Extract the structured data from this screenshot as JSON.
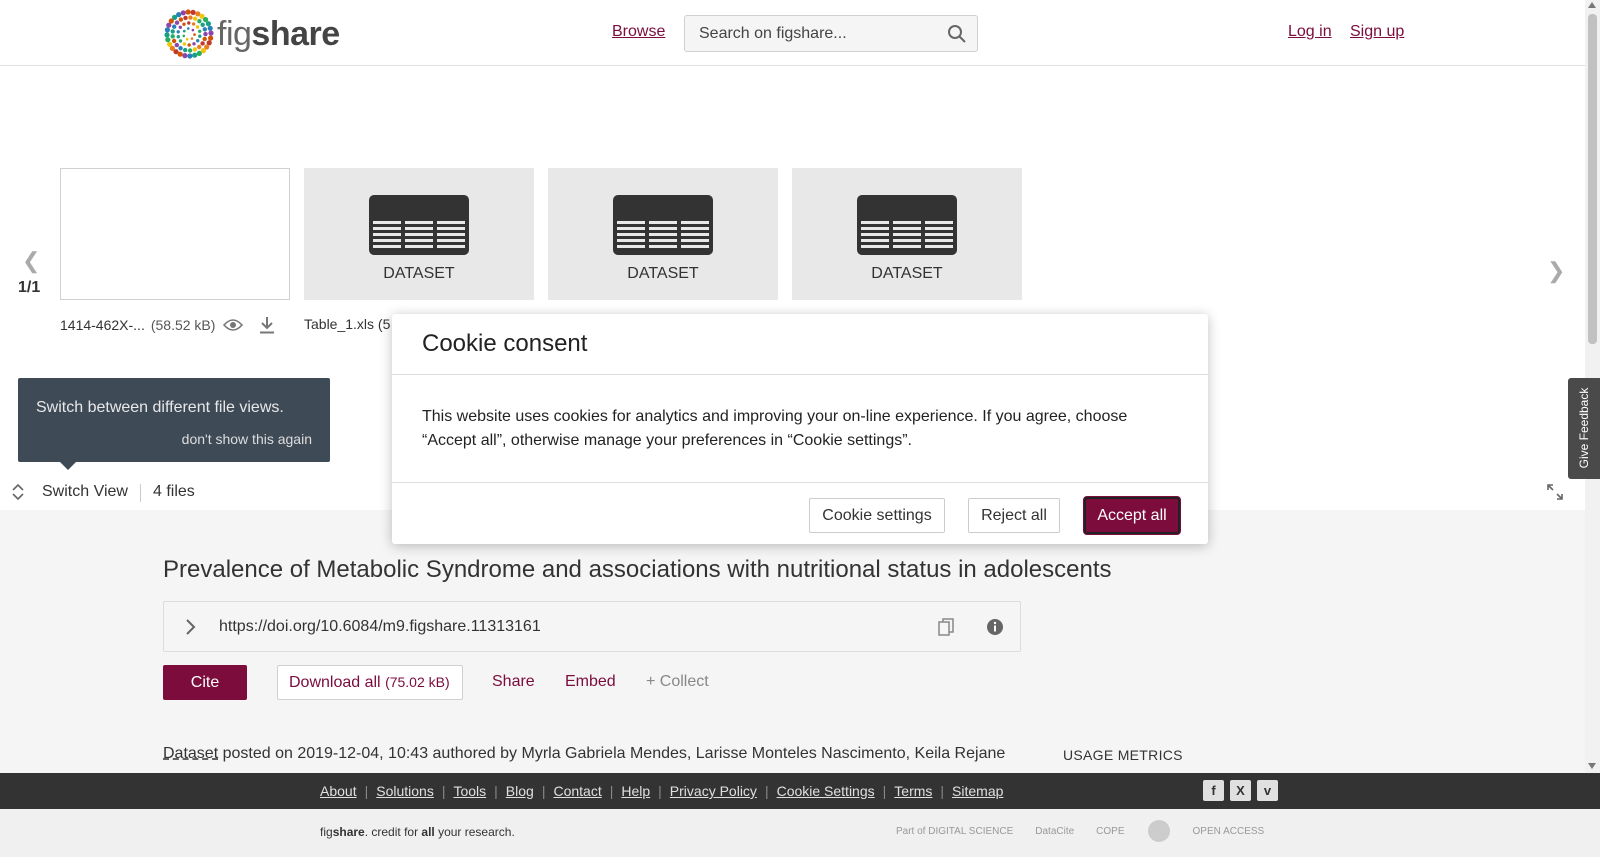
{
  "header": {
    "logo_text_light": "fig",
    "logo_text_bold": "share",
    "browse_label": "Browse",
    "search_placeholder": "Search on figshare...",
    "login_label": "Log in",
    "signup_label": "Sign up"
  },
  "carousel": {
    "page_indicator": "1/1",
    "thumbnails": [
      {
        "label": ""
      },
      {
        "label": "DATASET"
      },
      {
        "label": "DATASET"
      },
      {
        "label": "DATASET"
      }
    ],
    "files": [
      {
        "name": "1414-462X-...",
        "size": "(58.52 kB)"
      },
      {
        "name": "Table_1.xls (5"
      }
    ]
  },
  "tip": {
    "text": "Switch between different file views.",
    "dismiss": "don't show this again"
  },
  "switch_bar": {
    "switch_label": "Switch View",
    "file_count": "4 files"
  },
  "dataset": {
    "title": "Prevalence of Metabolic Syndrome and associations with nutritional status in adolescents",
    "doi": "https://doi.org/10.6084/m9.figshare.11313161",
    "cite_label": "Cite",
    "download_label": "Download all",
    "download_size": "(75.02 kB)",
    "share_label": "Share",
    "embed_label": "Embed",
    "collect_label": "+ Collect",
    "type_link": "Dataset",
    "posted_text": " posted on 2019-12-04, 10:43 authored by Myrla Gabriela Mendes, Larisse Monteles Nascimento, Keila Rejane",
    "usage_label": "USAGE METRICS"
  },
  "feedback_label": "Give Feedback",
  "footer": {
    "links": [
      "About",
      "Solutions",
      "Tools",
      "Blog",
      "Contact",
      "Help",
      "Privacy Policy",
      "Cookie Settings",
      "Terms",
      "Sitemap"
    ],
    "social": [
      "f",
      "X",
      "v"
    ],
    "tagline_pre": "fig",
    "tagline_bold": "share",
    "tagline_mid": ". credit for ",
    "tagline_bold2": "all",
    "tagline_post": " your research.",
    "partners": [
      "Part of DIGITAL SCIENCE",
      "DataCite",
      "COPE",
      "",
      "OPEN ACCESS"
    ]
  },
  "cookie_modal": {
    "title": "Cookie consent",
    "body": "This website uses cookies for analytics and improving your on-line experience. If you agree, choose “Accept all”, otherwise manage your preferences in “Cookie settings”.",
    "settings_label": "Cookie settings",
    "reject_label": "Reject all",
    "accept_label": "Accept all"
  },
  "colors": {
    "brand": "#7b0c3c",
    "tip_bg": "#3f4a57",
    "footer_bg": "#333333"
  }
}
